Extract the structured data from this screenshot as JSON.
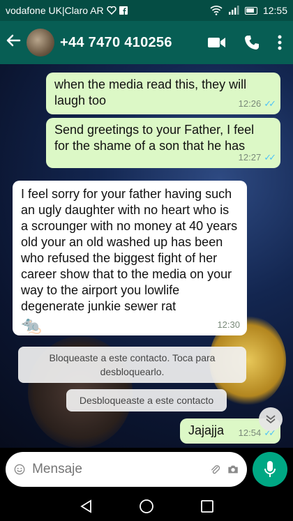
{
  "status": {
    "carrier": "vodafone UK|Claro AR",
    "time": "12:55"
  },
  "header": {
    "contact": "+44 7470 410256",
    "icons": [
      "back-arrow-icon",
      "video-call-icon",
      "phone-icon",
      "more-vert-icon"
    ]
  },
  "messages": [
    {
      "type": "out",
      "text": "when the media read this, they will laugh too",
      "time": "12:26"
    },
    {
      "type": "out",
      "text": "Send greetings to your Father, I feel for the shame of a son that he has",
      "time": "12:27"
    },
    {
      "type": "in",
      "text": "I feel sorry for your father having such an ugly daughter with no heart who is a scrounger with no money at 40 years old your an old washed up has been who refused the biggest fight of her career show that to the media on your way to the airport you lowlife degenerate junkie sewer rat",
      "emoji": "🐀",
      "time": "12:30"
    },
    {
      "type": "out",
      "text": "Jajajja",
      "time": "12:54"
    }
  ],
  "system": {
    "blocked": "Bloqueaste a este contacto. Toca para desbloquearlo.",
    "unblocked": "Desbloqueaste a este contacto"
  },
  "input": {
    "placeholder": "Mensaje"
  },
  "colors": {
    "header": "#075e54",
    "outgoing_bubble": "#dcf8c6",
    "incoming_bubble": "#ffffff",
    "accent": "#00a884",
    "read_ticks": "#4fc3f7"
  }
}
